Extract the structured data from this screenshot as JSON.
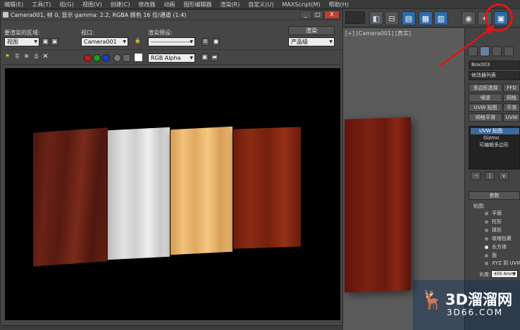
{
  "menubar": {
    "items": [
      "编辑(E)",
      "工具(T)",
      "组(G)",
      "视图(V)",
      "创建(C)",
      "修改器",
      "动画",
      "图形编辑器",
      "渲染(R)",
      "自定义(U)",
      "MAXScript(M)",
      "帮助(H)"
    ]
  },
  "render_window": {
    "title": "Camera001, 帧 0, 显示 gamma: 2.2, RGBA 颜色 16 位/通道 (1:4)",
    "area_label": "要渲染的区域:",
    "area_value": "视图",
    "viewport_label": "视口:",
    "viewport_value": "Camera001",
    "preset_label": "渲染预设:",
    "preset_value": "--------------------",
    "render_button": "渲染",
    "output_value": "产品级",
    "channel_value": "RGB Alpha",
    "min": "_",
    "max": "□",
    "close": "X"
  },
  "viewport": {
    "label": "[+] [Camera001] [真实]"
  },
  "command_panel": {
    "object_name": "Box003",
    "modifier_list": "修改器列表",
    "buttons": [
      "多边形选择",
      "FFD",
      "噪波",
      "网格",
      "UVW 贴图",
      "平滑",
      "网格平滑",
      "UVW"
    ],
    "stack": [
      "UVW 贴图",
      "Gizmo",
      "可编辑多边形"
    ],
    "params_header": "参数",
    "mapping_label": "贴图:",
    "mapping_options": [
      "平面",
      "柱形",
      "球形",
      "收缩包裹",
      "长方体",
      "面",
      "XYZ 到 UVW"
    ],
    "mapping_selected": "长方体",
    "length_label": "长度:",
    "length_value": "400.4mm"
  },
  "watermark": {
    "brand": "3D溜溜网",
    "url": "3D66.COM"
  },
  "colors": {
    "annotation": "#e01515",
    "close_button": "#c33e2c",
    "selected": "#3c6aa0"
  },
  "icons": {
    "red_swatch": "red-channel-icon",
    "green_swatch": "green-channel-icon",
    "blue_swatch": "blue-channel-icon",
    "render_frame": "render-frame-window-icon"
  }
}
